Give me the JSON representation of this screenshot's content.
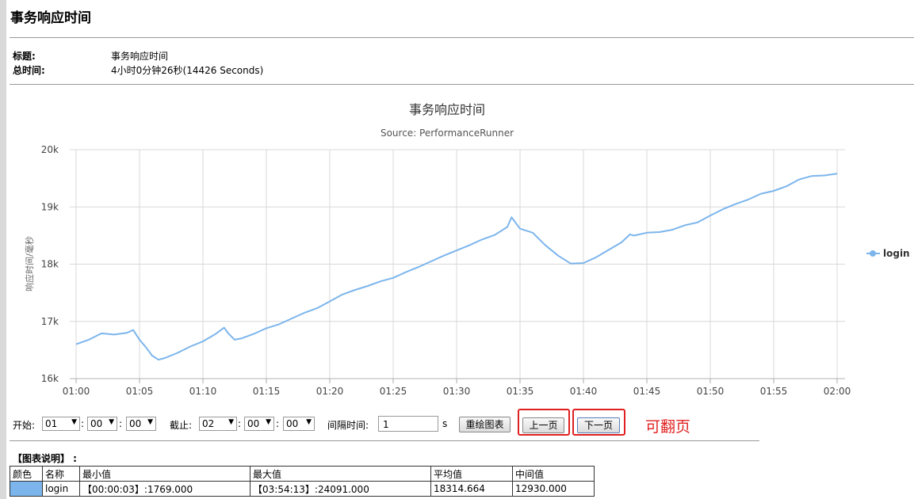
{
  "page": {
    "title": "事务响应时间"
  },
  "info": {
    "title_label": "标题:",
    "title_value": "事务响应时间",
    "total_label": "总时间:",
    "total_value": "4小时0分钟26秒(14426 Seconds)"
  },
  "chart_data": {
    "type": "line",
    "title": "事务响应时间",
    "subtitle": "Source: PerformanceRunner",
    "ylabel": "响应时间/毫秒",
    "xlabel": "",
    "ylim": [
      16000,
      20000
    ],
    "yticks": [
      16000,
      17000,
      18000,
      19000,
      20000
    ],
    "ytick_labels": [
      "16k",
      "17k",
      "18k",
      "19k",
      "20k"
    ],
    "xlim_minutes": [
      60,
      120
    ],
    "xticks": [
      "01:00",
      "01:05",
      "01:10",
      "01:15",
      "01:20",
      "01:25",
      "01:30",
      "01:35",
      "01:40",
      "01:45",
      "01:50",
      "01:55",
      "02:00"
    ],
    "grid": true,
    "legend_position": "right",
    "series": [
      {
        "name": "login",
        "color": "#7cb5ec",
        "x": [
          "01:00",
          "01:01",
          "01:02",
          "01:03",
          "01:04",
          "01:04:30",
          "01:05",
          "01:05:30",
          "01:06",
          "01:06:30",
          "01:07",
          "01:08",
          "01:09",
          "01:10",
          "01:11",
          "01:11:40",
          "01:12",
          "01:12:30",
          "01:13",
          "01:14",
          "01:15",
          "01:16",
          "01:17",
          "01:18",
          "01:19",
          "01:20",
          "01:21",
          "01:22",
          "01:23",
          "01:24",
          "01:25",
          "01:26",
          "01:27",
          "01:28",
          "01:29",
          "01:30",
          "01:31",
          "01:32",
          "01:33",
          "01:34",
          "01:34:20",
          "01:35",
          "01:36",
          "01:37",
          "01:38",
          "01:39",
          "01:40",
          "01:41",
          "01:42",
          "01:43",
          "01:43:40",
          "01:44",
          "01:45",
          "01:46",
          "01:47",
          "01:48",
          "01:49",
          "01:50",
          "01:51",
          "01:52",
          "01:53",
          "01:54",
          "01:55",
          "01:56",
          "01:57",
          "01:58",
          "01:59",
          "02:00"
        ],
        "values": [
          16600,
          16680,
          16790,
          16770,
          16800,
          16850,
          16680,
          16550,
          16400,
          16330,
          16360,
          16450,
          16560,
          16650,
          16780,
          16890,
          16790,
          16680,
          16700,
          16780,
          16880,
          16950,
          17050,
          17150,
          17230,
          17350,
          17470,
          17550,
          17620,
          17700,
          17760,
          17860,
          17950,
          18050,
          18150,
          18240,
          18330,
          18430,
          18510,
          18650,
          18820,
          18620,
          18550,
          18330,
          18150,
          18010,
          18020,
          18120,
          18250,
          18380,
          18520,
          18500,
          18550,
          18560,
          18600,
          18680,
          18730,
          18850,
          18960,
          19050,
          19130,
          19230,
          19280,
          19360,
          19480,
          19540,
          19550,
          19580
        ]
      }
    ]
  },
  "controls": {
    "start_label": "开始:",
    "start_h": "01",
    "start_m": "00",
    "start_s": "00",
    "end_label": "截止:",
    "end_h": "02",
    "end_m": "00",
    "end_s": "00",
    "interval_label": "间隔时间:",
    "interval_value": "1",
    "interval_unit": "s",
    "redraw_button": "重绘图表",
    "prev_button": "上一页",
    "next_button": "下一页",
    "annotation": "可翻页"
  },
  "legend_section": {
    "title": "【图表说明】 :",
    "headers": [
      "颜色",
      "名称",
      "最小值",
      "最大值",
      "平均值",
      "中间值"
    ],
    "rows": [
      {
        "color": "#7cb5ec",
        "name": "login",
        "min": "【00:00:03】:1769.000",
        "max": "【03:54:13】:24091.000",
        "avg": "18314.664",
        "median": "12930.000"
      }
    ]
  }
}
